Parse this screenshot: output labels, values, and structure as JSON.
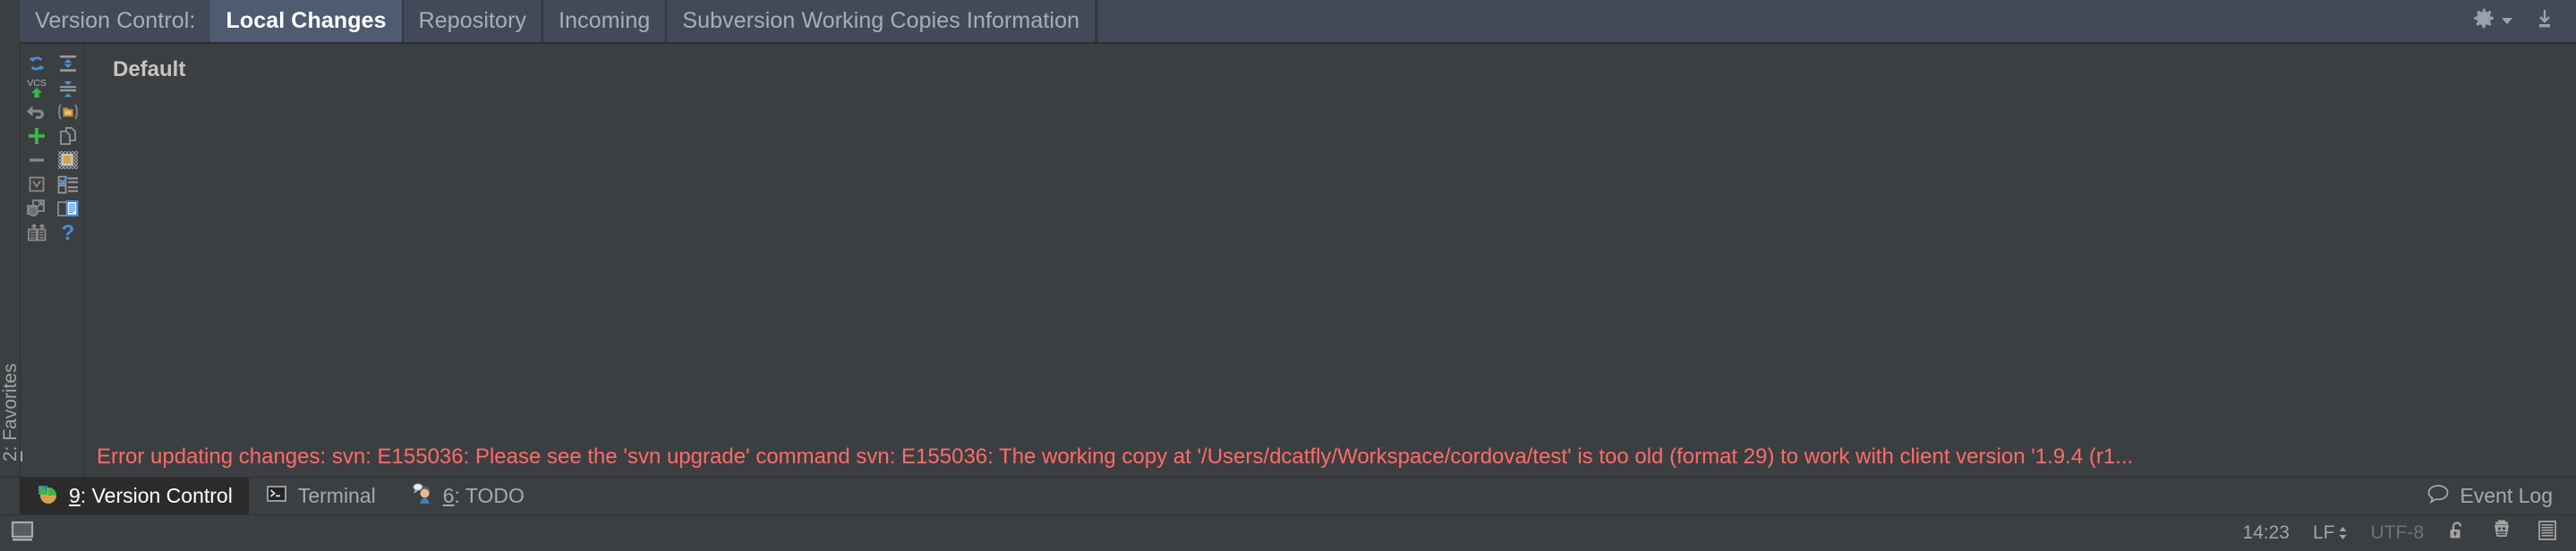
{
  "window": {
    "theme_bg": "#3c3f41",
    "tabbar_bg": "#424a59",
    "active_tab_bg": "#4f5b70",
    "error_color": "#ff6b68"
  },
  "tabbar": {
    "title": "Version Control:",
    "tabs": [
      {
        "label": "Local Changes",
        "active": true
      },
      {
        "label": "Repository",
        "active": false
      },
      {
        "label": "Incoming",
        "active": false
      },
      {
        "label": "Subversion Working Copies Information",
        "active": false
      }
    ],
    "actions": [
      {
        "name": "settings-gear-icon",
        "label": ""
      },
      {
        "name": "chevron-down-icon",
        "label": ""
      },
      {
        "name": "hide-window-icon",
        "label": ""
      }
    ]
  },
  "side_stripe": {
    "buttons": [
      {
        "index": "2",
        "label": ": Favorites",
        "full": "2: Favorites"
      }
    ],
    "star_glyph": "★"
  },
  "toolbar": {
    "buttons": [
      {
        "name": "refresh-icon",
        "tooltip": "Refresh"
      },
      {
        "name": "expand-all-icon",
        "tooltip": "Expand All"
      },
      {
        "name": "commit-vcs-icon",
        "tooltip": "Commit"
      },
      {
        "name": "collapse-all-icon",
        "tooltip": "Collapse All"
      },
      {
        "name": "revert-icon",
        "tooltip": "Revert"
      },
      {
        "name": "group-by-directory-icon",
        "tooltip": "Group by directory"
      },
      {
        "name": "add-changelist-icon",
        "tooltip": "New Changelist"
      },
      {
        "name": "copy-icon",
        "tooltip": "Copy"
      },
      {
        "name": "remove-changelist-icon",
        "tooltip": "Delete Changelist"
      },
      {
        "name": "show-diff-preview-icon",
        "tooltip": "Preview Diff"
      },
      {
        "name": "set-active-changelist-icon",
        "tooltip": "Set Active Changelist"
      },
      {
        "name": "show-ignored-icon",
        "tooltip": "Show Ignored Files"
      },
      {
        "name": "move-to-another-changelist-icon",
        "tooltip": "Move to Another Changelist"
      },
      {
        "name": "shelve-icon",
        "tooltip": "Shelve Changes"
      },
      {
        "name": "rollback-icon",
        "tooltip": "Rollback"
      },
      {
        "name": "help-icon",
        "tooltip": "Help"
      }
    ]
  },
  "changes": {
    "changelist_name": "Default",
    "error_message": "Error updating changes: svn: E155036: Please see the 'svn upgrade' command svn: E155036: The working copy at '/Users/dcatfly/Workspace/cordova/test' is too old (format 29) to work with client version '1.9.4 (r1..."
  },
  "toolwindow_bar": {
    "buttons": [
      {
        "name": "version-control",
        "index": "9",
        "label": ": Version Control",
        "icon": "version-control-icon",
        "active": true
      },
      {
        "name": "terminal",
        "index": "",
        "label": "Terminal",
        "icon": "terminal-icon",
        "active": false
      },
      {
        "name": "todo",
        "index": "6",
        "label": ": TODO",
        "icon": "todo-icon",
        "active": false
      }
    ],
    "right": {
      "label": "Event Log",
      "icon": "event-log-icon"
    }
  },
  "statusbar": {
    "time": "14:23",
    "line_separator": "LF",
    "encoding": "UTF-8",
    "lock_icon": "unlocked-icon",
    "inspector_icon": "hector-inspector-icon",
    "memory_icon": "memory-indicator-icon",
    "screen_icon": "screen-icon"
  }
}
